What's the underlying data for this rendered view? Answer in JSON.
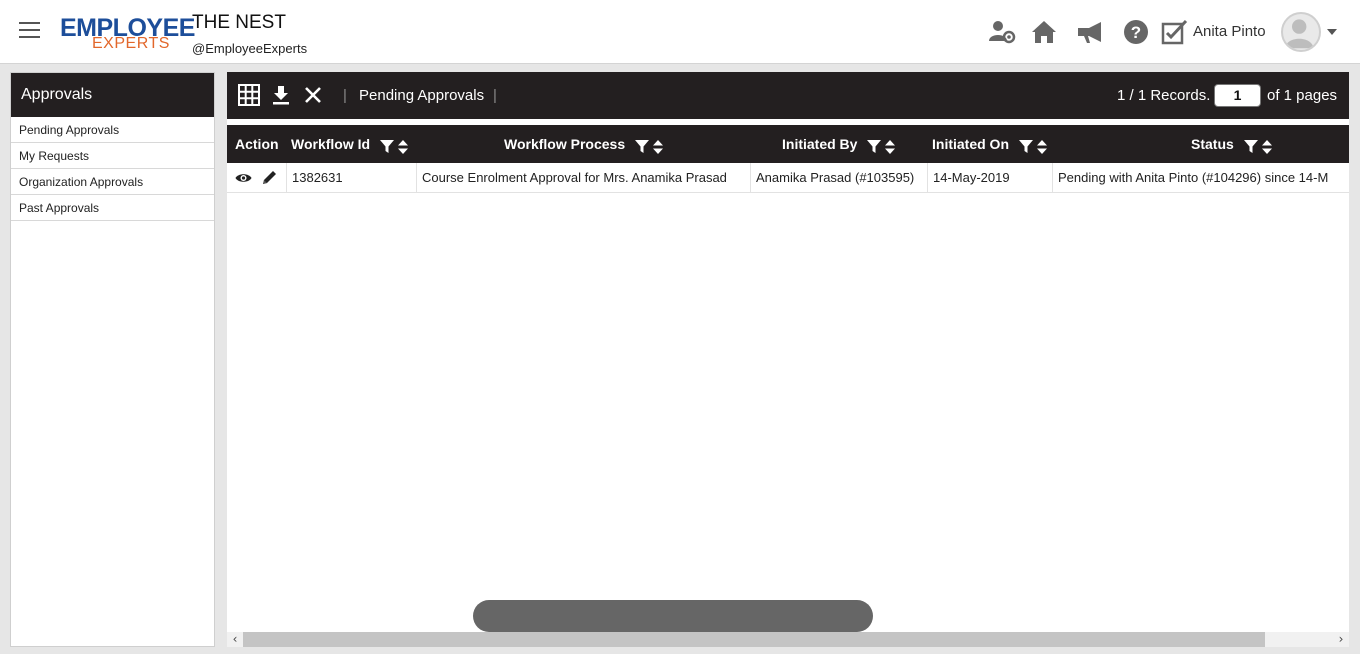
{
  "header": {
    "logo_line1": "EMPLOYEE",
    "logo_line2": "EXPERTS",
    "title": "THE NEST",
    "handle": "@EmployeeExperts",
    "user_name": "Anita Pinto",
    "icons": [
      "team-settings-icon",
      "home-icon",
      "megaphone-icon",
      "help-icon",
      "checklist-icon"
    ]
  },
  "sidebar": {
    "title": "Approvals",
    "items": [
      {
        "label": "Pending Approvals"
      },
      {
        "label": "My Requests"
      },
      {
        "label": "Organization Approvals"
      },
      {
        "label": "Past Approvals"
      }
    ]
  },
  "toolbar": {
    "title": "Pending Approvals",
    "separator": "|",
    "records_text": "1 / 1 Records.",
    "page_value": "1",
    "pages_text": "of 1 pages",
    "icons": [
      "grid-icon",
      "download-icon",
      "close-icon"
    ]
  },
  "table": {
    "columns": [
      {
        "label": "Action"
      },
      {
        "label": "Workflow Id"
      },
      {
        "label": "Workflow Process"
      },
      {
        "label": "Initiated By"
      },
      {
        "label": "Initiated On"
      },
      {
        "label": "Status"
      }
    ],
    "rows": [
      {
        "workflow_id": "1382631",
        "workflow_process": "Course Enrolment Approval for Mrs. Anamika Prasad",
        "initiated_by": "Anamika Prasad (#103595)",
        "initiated_on": "14-May-2019",
        "status": "Pending with Anita Pinto (#104296) since 14-M"
      }
    ]
  },
  "colors": {
    "dark_bar": "#231f20",
    "logo_blue": "#1d4e9a",
    "logo_orange": "#e2672b"
  }
}
